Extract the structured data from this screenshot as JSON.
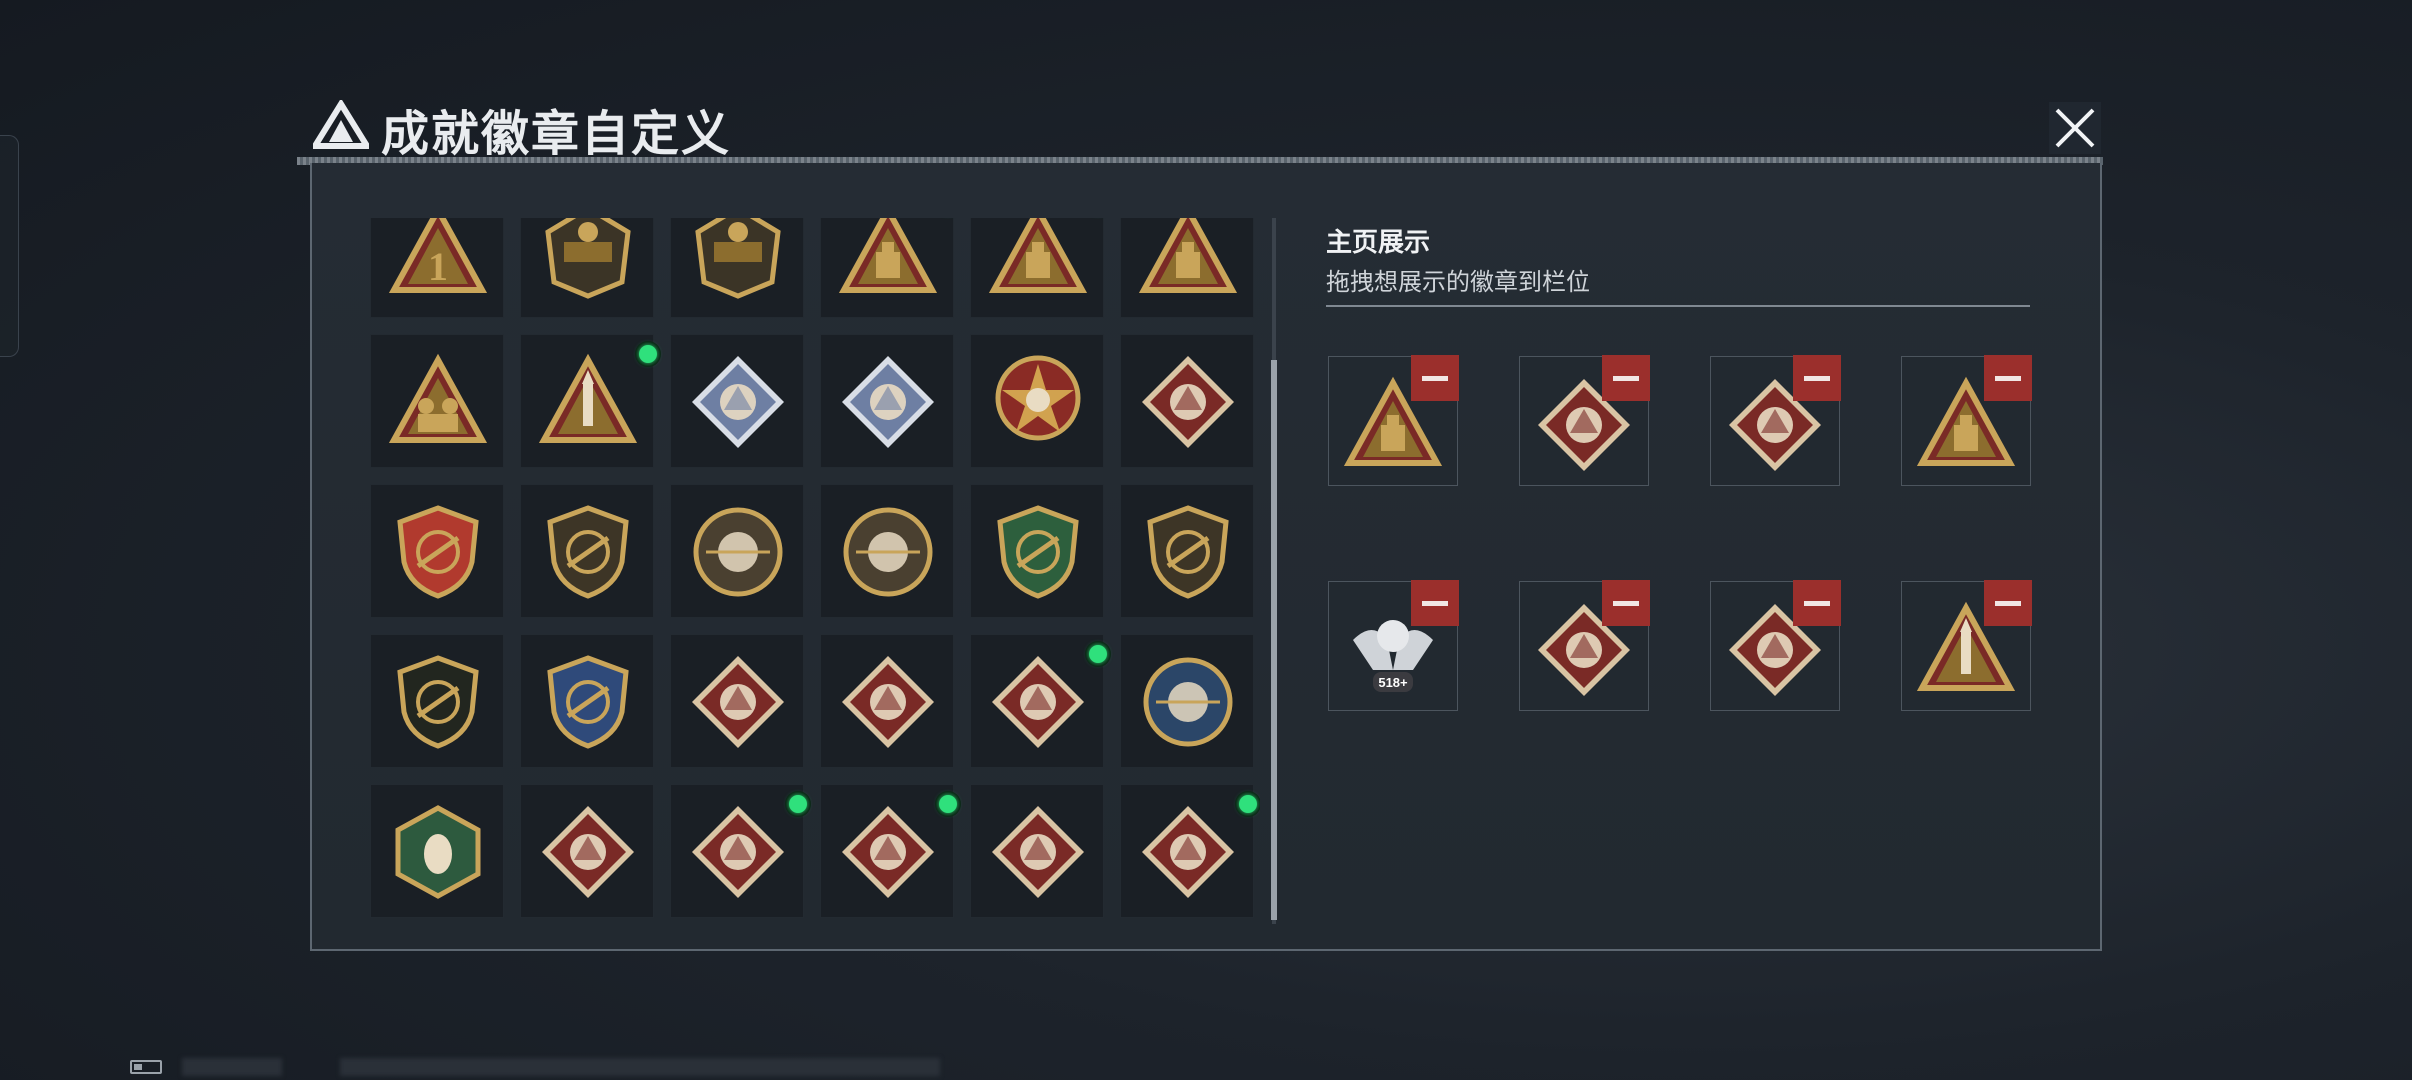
{
  "window": {
    "title": "成就徽章自定义",
    "colors": {
      "panel_bg": "#242a31",
      "accent_new": "#2fe07c",
      "remove_red": "#9b2f2c",
      "badge_gold": "#c9a55a",
      "badge_crimson": "#7a2a26"
    }
  },
  "icons": {
    "logo": "delta-triangle-logo-icon",
    "close": "close-x-icon",
    "remove": "minus-icon",
    "new": "new-indicator-dot"
  },
  "badge_grid": {
    "rows": [
      [
        {
          "icon": "gold-triangle-number-one-badge-icon",
          "new": false
        },
        {
          "icon": "delta-force-train-emblem-icon",
          "new": false
        },
        {
          "icon": "delta-force-2025-emblem-icon",
          "new": false
        },
        {
          "icon": "gold-triangle-supply-box-badge-icon",
          "new": true
        },
        {
          "icon": "gold-triangle-helmet-badge-icon",
          "new": true
        },
        {
          "icon": "gold-triangle-dice-hands-badge-icon",
          "new": false
        }
      ],
      [
        {
          "icon": "gold-triangle-soldiers-badge-icon",
          "new": false
        },
        {
          "icon": "gold-triangle-rocket-badge-icon",
          "new": true
        },
        {
          "icon": "blue-diamond-fist-badge-icon",
          "new": false
        },
        {
          "icon": "blue-diamond-tank-badge-icon",
          "new": false
        },
        {
          "icon": "red-star-skull-medal-icon",
          "new": false
        },
        {
          "icon": "green-shield-diamond-badge-icon",
          "new": false
        }
      ],
      [
        {
          "icon": "winged-shield-crest-badge-icon",
          "new": false
        },
        {
          "icon": "bronze-shield-dice-badge-icon",
          "new": false
        },
        {
          "icon": "round-skull-crosshair-badge-icon",
          "new": false
        },
        {
          "icon": "round-bear-face-badge-icon",
          "new": false
        },
        {
          "icon": "green-rifle-scope-badge-icon",
          "new": false
        },
        {
          "icon": "bronze-shield-rifle-badge-icon",
          "new": false
        }
      ],
      [
        {
          "icon": "dark-shield-rifle-badge-icon",
          "new": false
        },
        {
          "icon": "blue-gold-rifle-crest-badge-icon",
          "new": false
        },
        {
          "icon": "crimson-diamond-wolf-badge-icon",
          "new": false
        },
        {
          "icon": "crimson-diamond-wolf-two-badge-icon",
          "new": false
        },
        {
          "icon": "crimson-diamond-runner-badge-icon",
          "new": true
        },
        {
          "icon": "round-eagle-badge-icon",
          "new": false
        }
      ],
      [
        {
          "icon": "green-hexagon-wasp-badge-icon",
          "new": false
        },
        {
          "icon": "crimson-diamond-dragon-badge-icon",
          "new": false
        },
        {
          "icon": "crimson-diamond-runner-badge-icon",
          "new": true
        },
        {
          "icon": "crimson-diamond-wheel-badge-icon",
          "new": true
        },
        {
          "icon": "crimson-diamond-horse-badge-icon",
          "new": false
        },
        {
          "icon": "crimson-diamond-tools-badge-icon",
          "new": true
        }
      ]
    ]
  },
  "showcase": {
    "title": "主页展示",
    "subtitle": "拖拽想展示的徽章到栏位",
    "slots": [
      {
        "icon": "gold-triangle-helmet-badge-icon"
      },
      {
        "icon": "crimson-diamond-runner-badge-icon"
      },
      {
        "icon": "crimson-diamond-runner-badge-icon"
      },
      {
        "icon": "gold-triangle-supply-box-badge-icon"
      },
      {
        "icon": "silver-winged-skull-518-badge-icon",
        "label": "518+"
      },
      {
        "icon": "crimson-diamond-tools-badge-icon"
      },
      {
        "icon": "crimson-diamond-wheel-badge-icon"
      },
      {
        "icon": "gold-triangle-rocket-badge-icon"
      }
    ]
  }
}
